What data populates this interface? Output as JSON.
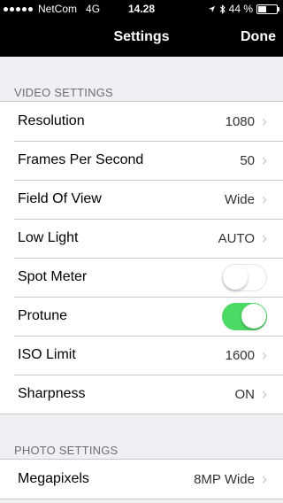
{
  "status_bar": {
    "carrier": "NetCom",
    "network": "4G",
    "time": "14.28",
    "battery_text": "44 %",
    "battery_level": 0.44
  },
  "nav": {
    "title": "Settings",
    "done_label": "Done"
  },
  "video_settings": {
    "header": "VIDEO SETTINGS",
    "rows": [
      {
        "label": "Resolution",
        "value": "1080"
      },
      {
        "label": "Frames Per Second",
        "value": "50"
      },
      {
        "label": "Field Of View",
        "value": "Wide"
      },
      {
        "label": "Low Light",
        "value": "AUTO"
      },
      {
        "label": "Spot Meter",
        "toggle": false
      },
      {
        "label": "Protune",
        "toggle": true
      },
      {
        "label": "ISO Limit",
        "value": "1600"
      },
      {
        "label": "Sharpness",
        "value": "ON"
      }
    ]
  },
  "photo_settings": {
    "header": "PHOTO SETTINGS",
    "rows": [
      {
        "label": "Megapixels",
        "value": "8MP Wide"
      }
    ]
  },
  "colors": {
    "toggle_on": "#4cd964",
    "nav_background": "#000000",
    "page_background": "#efeff4"
  }
}
